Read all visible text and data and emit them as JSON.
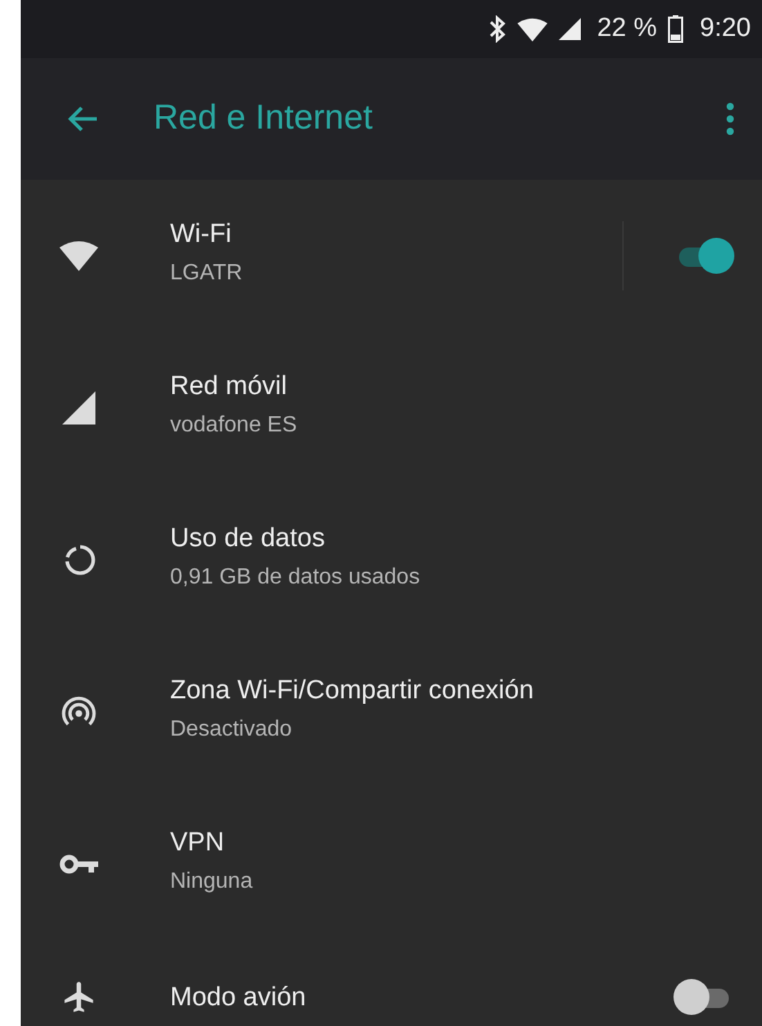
{
  "status_bar": {
    "battery": "22 %",
    "time": "9:20"
  },
  "toolbar": {
    "title": "Red e Internet"
  },
  "items": [
    {
      "kind": "toggle",
      "title": "Wi-Fi",
      "summary": "LGATR",
      "on": true
    },
    {
      "kind": "plain",
      "title": "Red móvil",
      "summary": "vodafone ES"
    },
    {
      "kind": "plain",
      "title": "Uso de datos",
      "summary": "0,91 GB de datos usados"
    },
    {
      "kind": "plain",
      "title": "Zona Wi-Fi/Compartir conexión",
      "summary": "Desactivado"
    },
    {
      "kind": "plain",
      "title": "VPN",
      "summary": "Ninguna"
    },
    {
      "kind": "toggle",
      "title": "Modo avión",
      "on": false
    }
  ]
}
